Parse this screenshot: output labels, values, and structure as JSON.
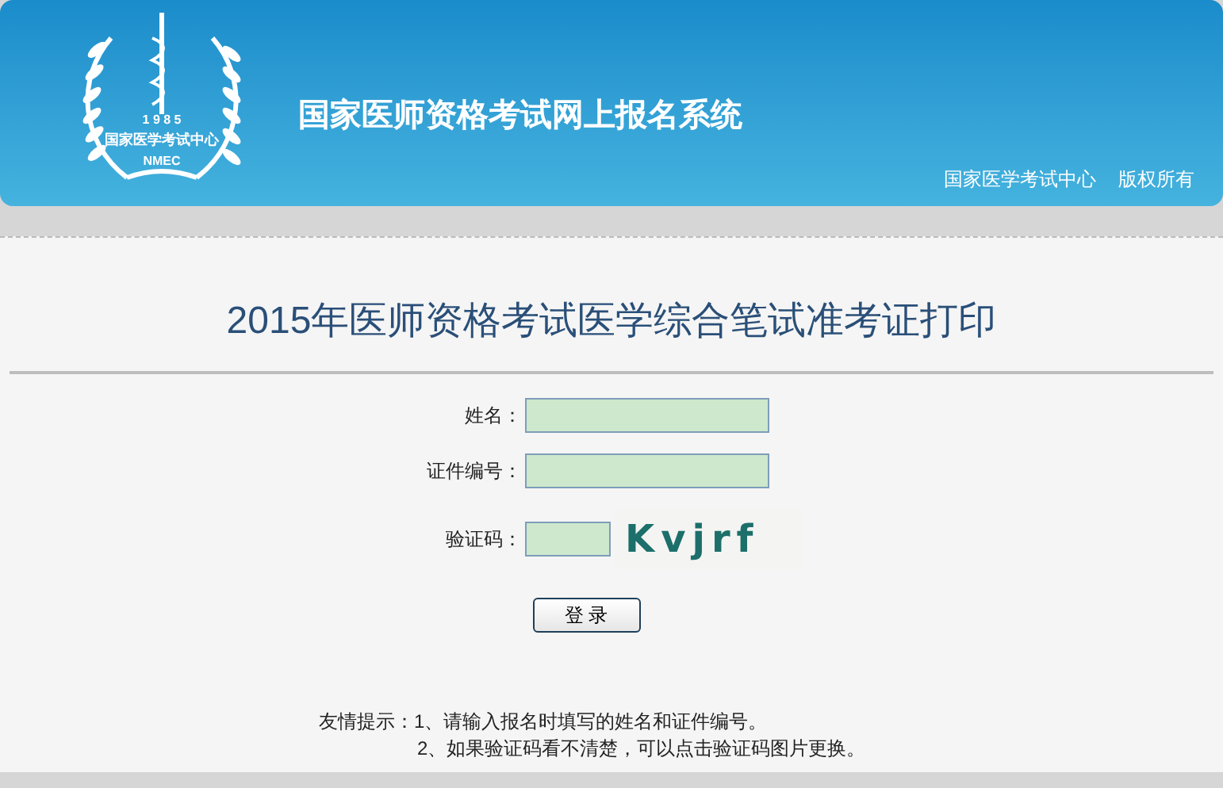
{
  "header": {
    "logo": {
      "year": "1 9 8 5",
      "org": "国家医学考试中心",
      "abbr": "NMEC"
    },
    "title": "国家医师资格考试网上报名系统",
    "links": [
      "国家医学考试中心",
      "版权所有"
    ]
  },
  "page_title": "2015年医师资格考试医学综合笔试准考证打印",
  "form": {
    "fields": [
      {
        "kind": "text",
        "label": "姓名："
      },
      {
        "kind": "text",
        "label": "证件编号："
      },
      {
        "kind": "captcha",
        "label": "验证码：",
        "code": "Kvjrf"
      }
    ],
    "submit": "登 录"
  },
  "tips": {
    "label": "友情提示：",
    "items": [
      "1、请输入报名时填写的姓名和证件编号。",
      "2、如果验证码看不清楚，可以点击验证码图片更换。"
    ]
  }
}
